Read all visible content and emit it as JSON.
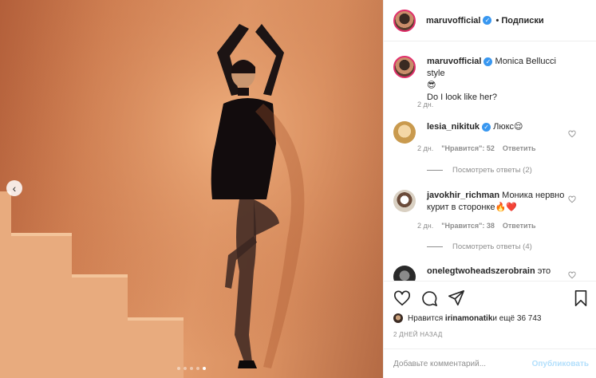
{
  "post": {
    "username": "maruvofficial",
    "follow_label": "• Подписки",
    "photo_alt": "photo",
    "carousel_count": 5,
    "carousel_active_index": 4
  },
  "caption": {
    "username": "maruvofficial",
    "text_line1": "Monica Bellucci style",
    "emoji": "😎",
    "text_line2": "Do I look like her?",
    "time": "2 дн."
  },
  "comments": [
    {
      "username": "lesia_nikituk",
      "verified": true,
      "text": "Люкс😌",
      "time": "2 дн.",
      "likes": "\"Нравится\": 52",
      "reply": "Ответить",
      "view_replies": "Посмотреть ответы (2)"
    },
    {
      "username": "javokhir_richman",
      "verified": false,
      "text": "Моника нервно курит в сторонке🔥❤️",
      "time": "2 дн.",
      "likes": "\"Нравится\": 38",
      "reply": "Ответить",
      "view_replies": "Посмотреть ответы (4)"
    },
    {
      "username": "onelegtwoheadszerobrain",
      "verified": false,
      "text": "это"
    }
  ],
  "actions": {
    "liked_by_prefix": "Нравится ",
    "liked_by_user": "irinamonatik",
    "liked_by_suffix": " и ещё 36 743",
    "date": "2 ДНЕЙ НАЗАД",
    "comment_placeholder": "Добавьте комментарий...",
    "publish_label": "Опубликовать"
  },
  "icons": {
    "heart": "heart-icon",
    "comment": "comment-icon",
    "share": "share-icon",
    "bookmark": "bookmark-icon",
    "verified": "verified-badge-icon",
    "prev": "chevron-left-icon"
  },
  "colors": {
    "verified": "#3897f0",
    "link_disabled": "#b2dffc",
    "muted": "#8e8e8e"
  }
}
